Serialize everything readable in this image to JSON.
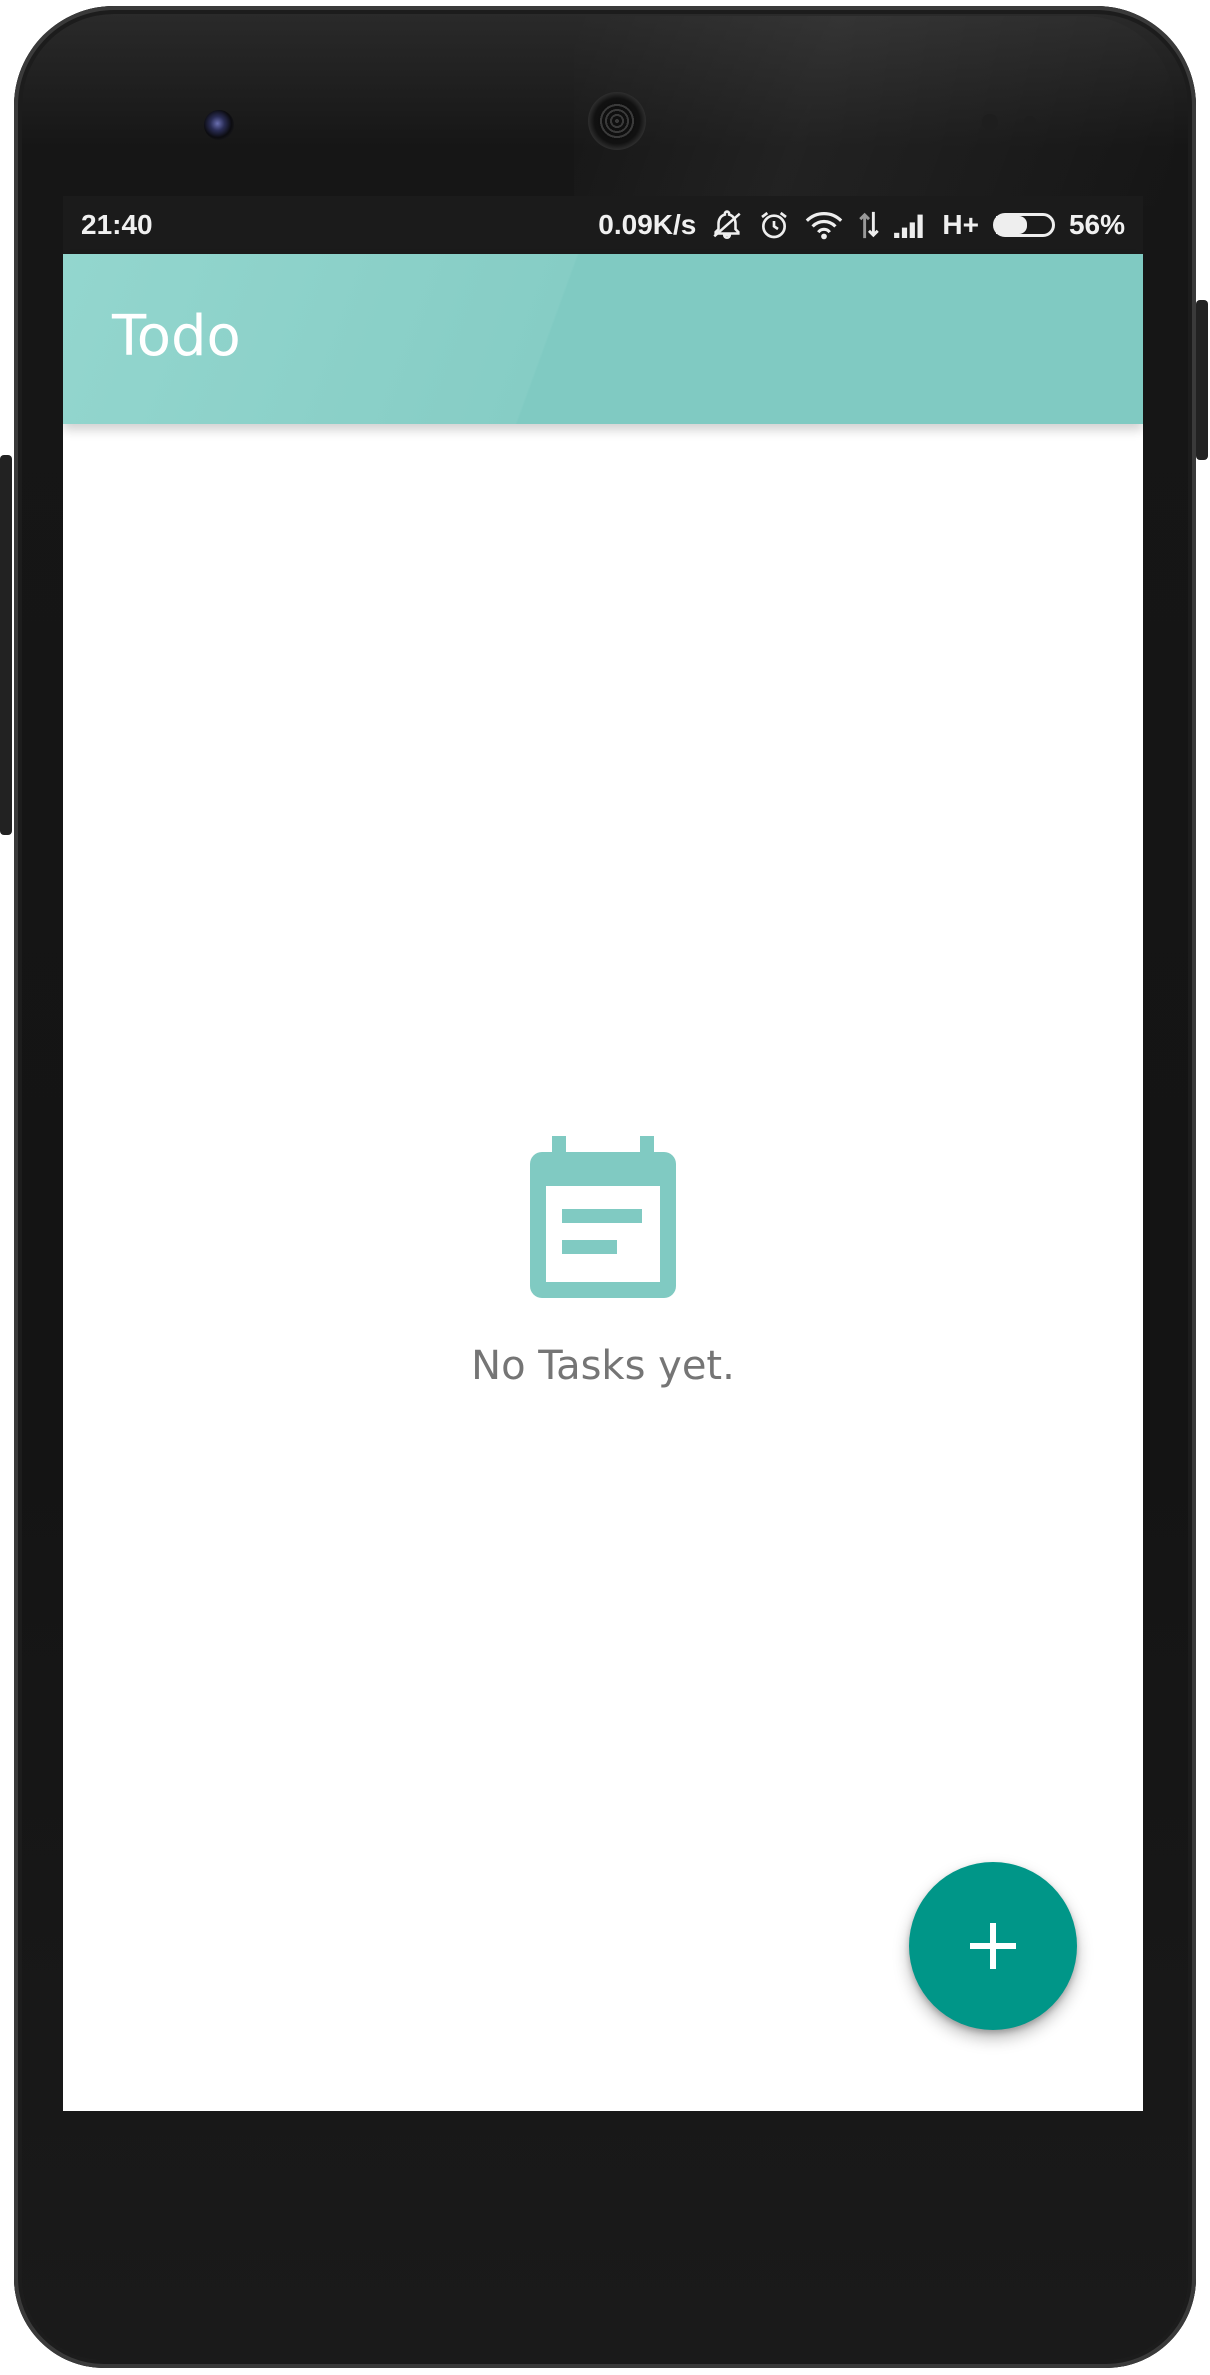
{
  "status_bar": {
    "time": "21:40",
    "network_speed": "0.09K/s",
    "network_type": "H+",
    "battery_percent": "56%",
    "battery_level": 0.56,
    "icons": [
      "notifications-off-icon",
      "alarm-icon",
      "wifi-icon",
      "data-transfer-icon",
      "signal-icon",
      "battery-icon"
    ]
  },
  "app_bar": {
    "title": "Todo"
  },
  "empty_state": {
    "icon": "calendar-note-icon",
    "message": "No Tasks yet."
  },
  "fab": {
    "icon": "plus-icon"
  },
  "colors": {
    "app_bar": "#80cac2",
    "accent": "#009688",
    "empty_icon": "#80cac2",
    "empty_text": "#757575",
    "status_bar": "#1b1b1b"
  }
}
